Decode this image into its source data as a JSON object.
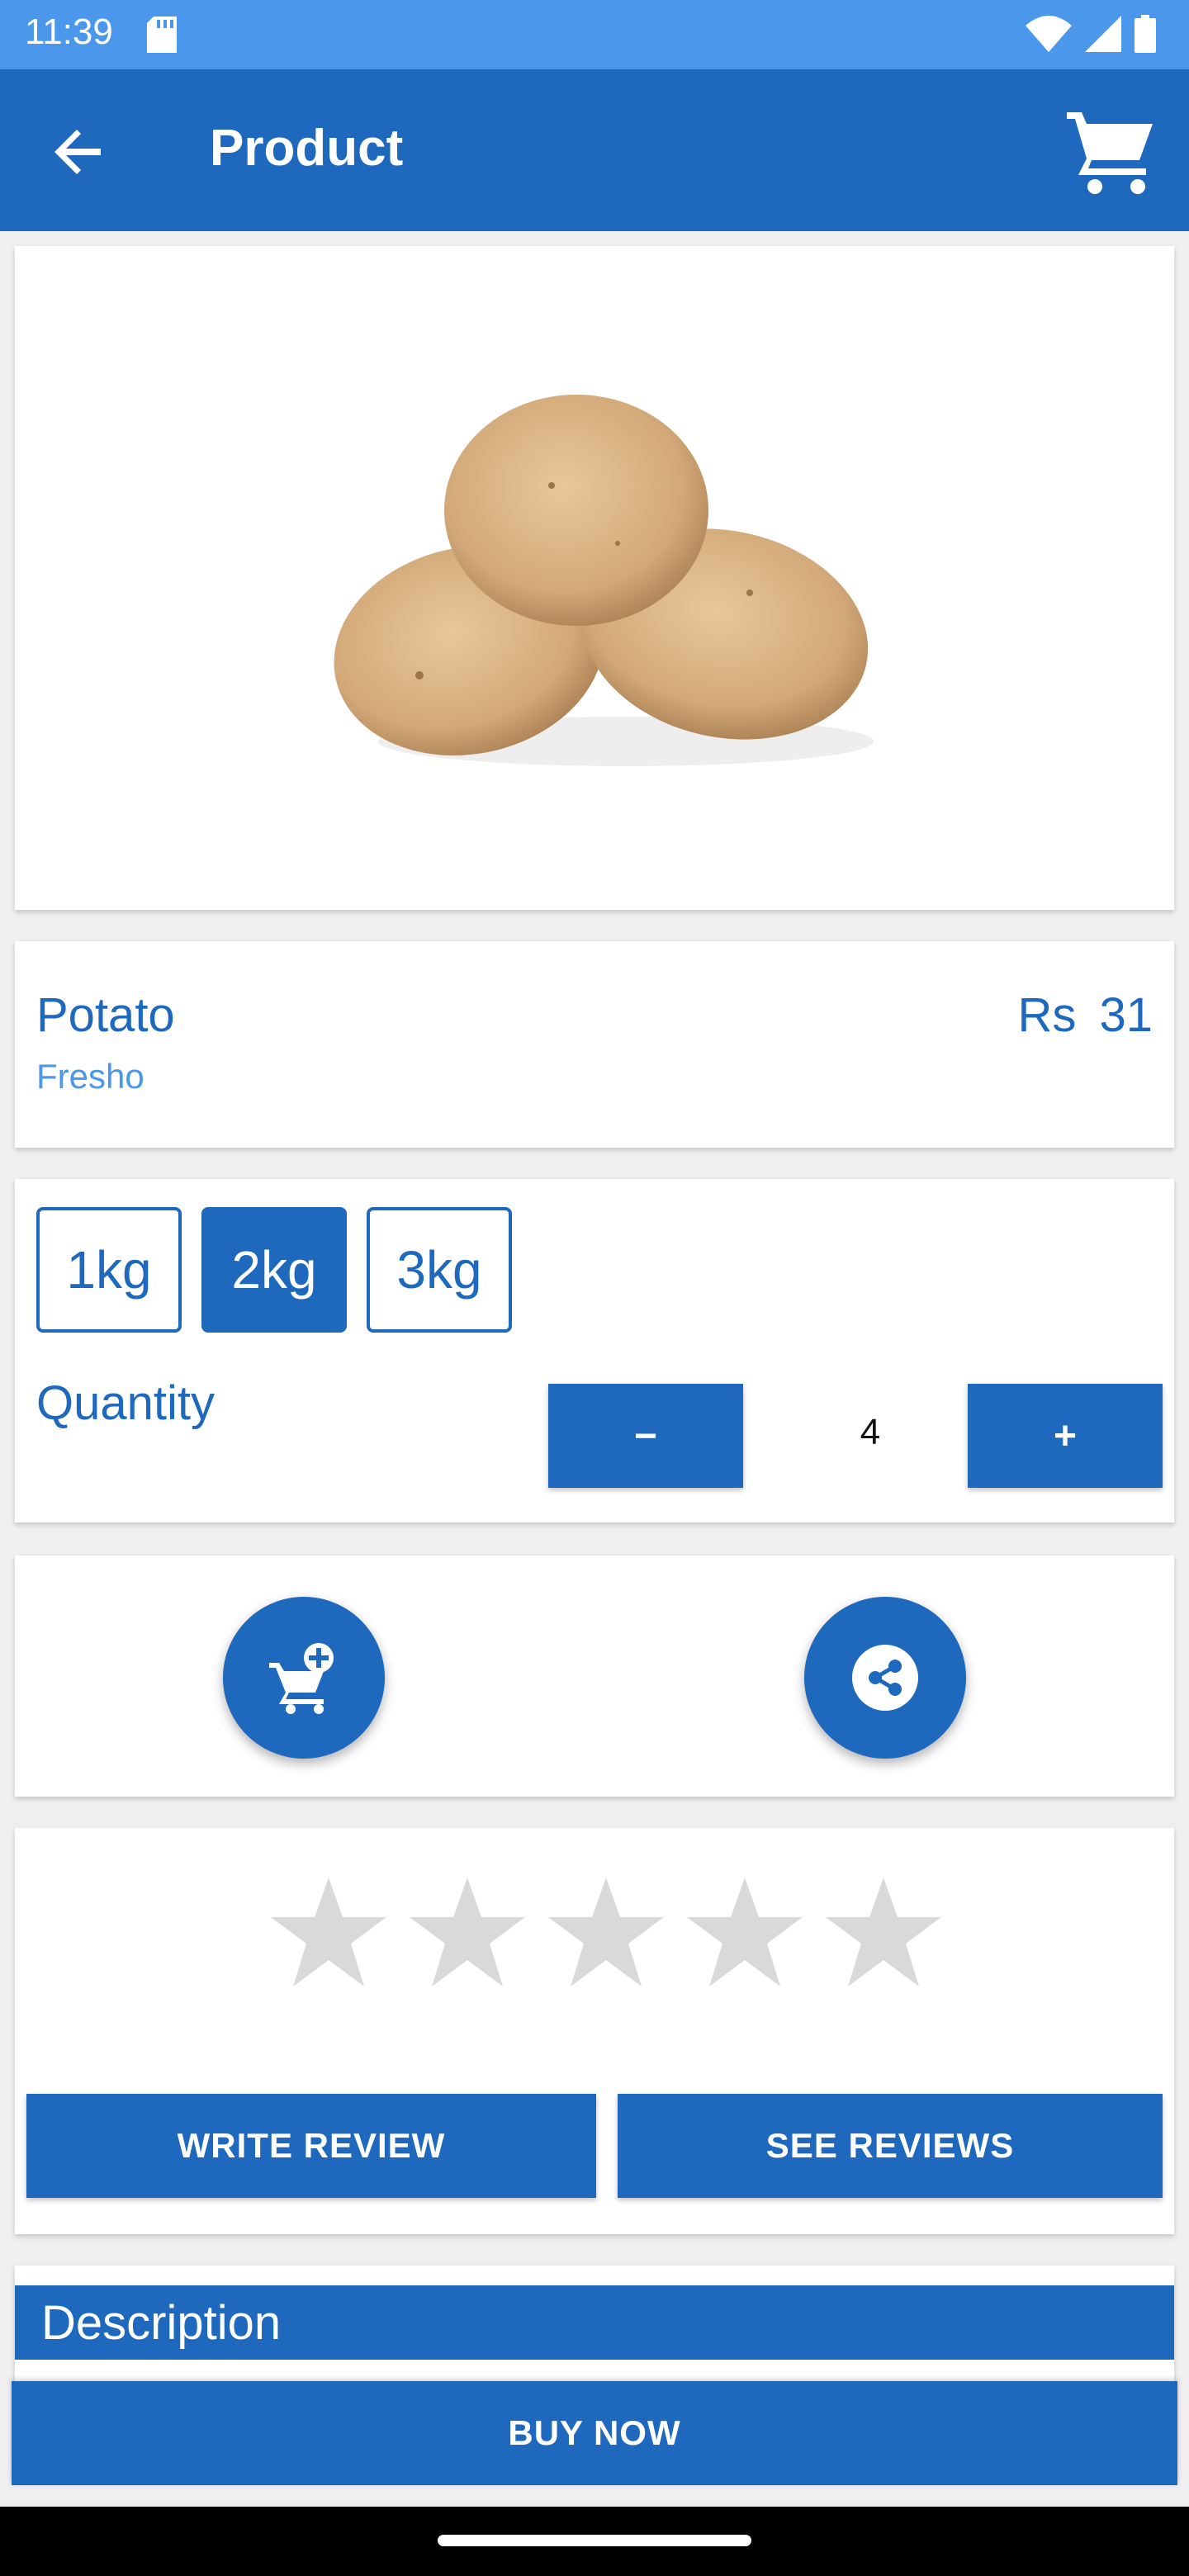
{
  "status_bar": {
    "time": "11:39"
  },
  "app_bar": {
    "title": "Product"
  },
  "product": {
    "name": "Potato",
    "brand": "Fresho",
    "price": "Rs 31"
  },
  "sizes": [
    "1kg",
    "2kg",
    "3kg"
  ],
  "selected_size": "2kg",
  "quantity": {
    "label": "Quantity",
    "value": "4",
    "minus_label": "−",
    "plus_label": "+"
  },
  "rating": {
    "stars_total": 5,
    "stars_filled": 0
  },
  "reviews": {
    "write_label": "WRITE REVIEW",
    "see_label": "SEE REVIEWS"
  },
  "description": {
    "heading": "Description"
  },
  "buy_now_label": "BUY NOW",
  "colors": {
    "primary": "#1e68be",
    "status_bar": "#4a97ec",
    "star_empty": "#d9d9d9"
  }
}
